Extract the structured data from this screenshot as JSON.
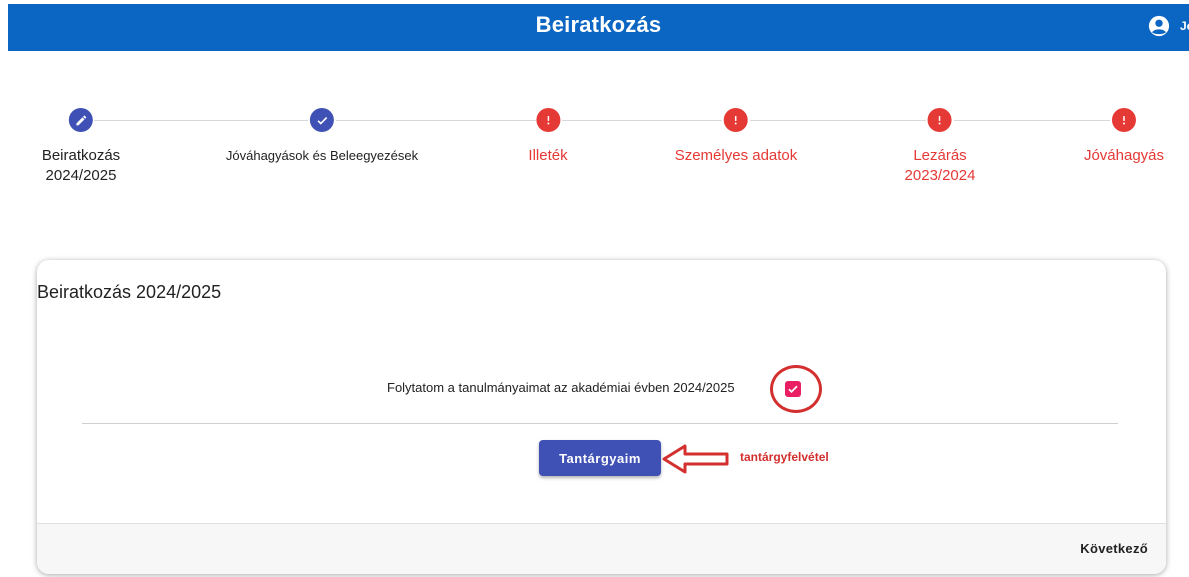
{
  "header": {
    "title": "Beiratkozás",
    "user_name": "Jel",
    "background_color": "#0a66c2",
    "user_icon": "account-circle-icon"
  },
  "stepper": {
    "steps": [
      {
        "label": "Beiratkozás\n2024/2025",
        "status": "edit",
        "icon": "pencil-icon",
        "color": "#3f51b5"
      },
      {
        "label": "Jóváhagyások és Beleegyezések",
        "status": "done",
        "icon": "check-icon",
        "color": "#3f51b5"
      },
      {
        "label": "Illeték",
        "status": "error",
        "icon": "exclamation-icon",
        "color": "#e53935"
      },
      {
        "label": "Személyes adatok",
        "status": "error",
        "icon": "exclamation-icon",
        "color": "#e53935"
      },
      {
        "label": "Lezárás\n2023/2024",
        "status": "error",
        "icon": "exclamation-icon",
        "color": "#e53935"
      },
      {
        "label": "Jóváhagyás",
        "status": "error",
        "icon": "exclamation-icon",
        "color": "#e53935"
      }
    ]
  },
  "card": {
    "title": "Beiratkozás 2024/2025",
    "confirm_text": "Folytatom a tanulmányaimat az akadémiai évben 2024/2025",
    "checkbox_checked": true,
    "checkbox_color": "#e91e63",
    "primary_button_label": "Tantárgyaim",
    "primary_button_color": "#3f51b5",
    "annotation_text": "tantárgyfelvétel",
    "annotation_color": "#d32f2f",
    "next_label": "Következő"
  }
}
